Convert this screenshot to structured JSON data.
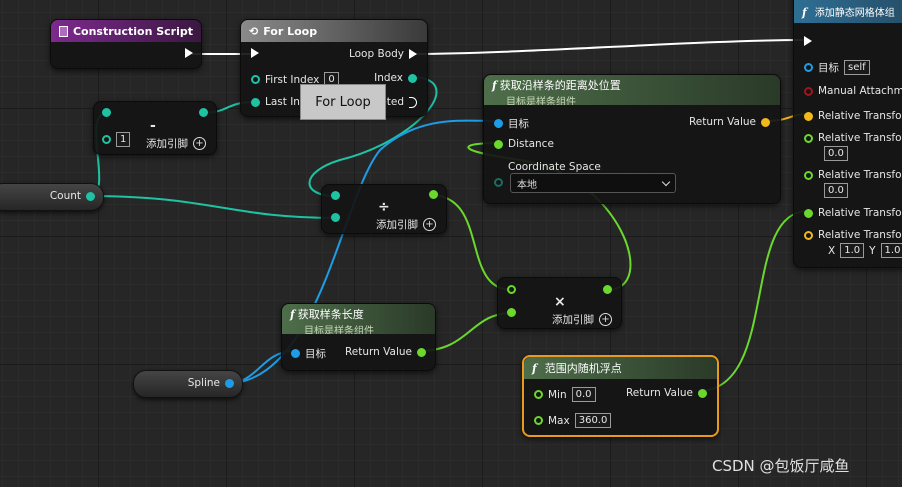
{
  "tooltip": {
    "text": "For Loop"
  },
  "watermark": "CSDN @包饭厅咸鱼",
  "nodes": {
    "construction_script": {
      "title": "Construction Script"
    },
    "for_loop": {
      "title": "For Loop",
      "loop_body": "Loop Body",
      "first_index": "First Index",
      "first_index_value": "0",
      "index": "Index",
      "last_index": "Last Index",
      "completed": "pleted"
    },
    "subtract": {
      "symbol": "-",
      "b_value": "1",
      "add_pin": "添加引脚"
    },
    "count": {
      "label": "Count"
    },
    "divide": {
      "symbol": "÷",
      "add_pin": "添加引脚"
    },
    "get_location": {
      "title": "获取沿样条的距离处位置",
      "subtitle": "目标是样条组件",
      "target": "目标",
      "return_value": "Return Value",
      "distance": "Distance",
      "coord_space": "Coordinate Space",
      "coord_space_value": "本地"
    },
    "add_mesh": {
      "title": "添加静态网格体组",
      "target": "目标",
      "self": "self",
      "manual_attach": "Manual Attachmen",
      "rt_location": "Relative Transform",
      "rt_rx": "Relative Transform",
      "rx_value": "0.0",
      "rt_ry": "Relative Transform",
      "ry_value": "0.0",
      "rt_rz": "Relative Transform",
      "rt_scale": "Relative Transform",
      "x": "X",
      "sx_value": "1.0",
      "y": "Y",
      "sy_value": "1.0"
    },
    "multiply": {
      "symbol": "×",
      "add_pin": "添加引脚"
    },
    "spline_length": {
      "title": "获取样条长度",
      "subtitle": "目标是样条组件",
      "target": "目标",
      "return_value": "Return Value"
    },
    "spline": {
      "label": "Spline"
    },
    "random_float": {
      "title": "范围内随机浮点",
      "min": "Min",
      "min_value": "0.0",
      "max": "Max",
      "max_value": "360.0",
      "return_value": "Return Value"
    }
  },
  "colors": {
    "exec": "#ffffff",
    "integer": "#1ec3a4",
    "float": "#6ad82c",
    "object": "#1d9de6",
    "vector": "#f2b91a",
    "selection": "#e89a1c"
  }
}
